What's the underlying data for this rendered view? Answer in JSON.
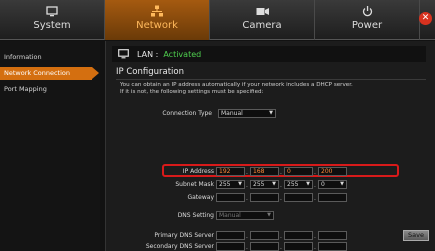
{
  "tabs": [
    {
      "label": "System",
      "icon": "monitor-icon"
    },
    {
      "label": "Network",
      "icon": "network-icon",
      "active": true
    },
    {
      "label": "Camera",
      "icon": "camera-icon"
    },
    {
      "label": "Power",
      "icon": "power-icon"
    }
  ],
  "close_icon": "close-icon",
  "sidebar": {
    "items": [
      {
        "label": "Information"
      },
      {
        "label": "Network Connection",
        "active": true
      },
      {
        "label": "Port Mapping"
      }
    ]
  },
  "lan": {
    "label": "LAN :",
    "status": "Activated"
  },
  "ip_config": {
    "title": "IP Configuration",
    "description_line1": "You can obtain an IP address automatically if your network includes a DHCP server.",
    "description_line2": "If it is not, the following settings must be specified:",
    "connection_type_label": "Connection Type",
    "connection_type_value": "Manual",
    "ip_address_label": "IP Address",
    "ip_address": [
      "192",
      "168",
      "0",
      "200"
    ],
    "subnet_mask_label": "Subnet Mask",
    "subnet_mask": [
      "255",
      "255",
      "255",
      "0"
    ],
    "gateway_label": "Gateway",
    "dns_setting_label": "DNS Setting",
    "dns_setting_value": "Manual",
    "primary_dns_label": "Primary DNS Server",
    "secondary_dns_label": "Secondary DNS Server"
  },
  "save_label": "Save",
  "colors": {
    "accent": "#d46f10",
    "status_ok": "#4fd14f",
    "highlight": "#d81a1a"
  }
}
